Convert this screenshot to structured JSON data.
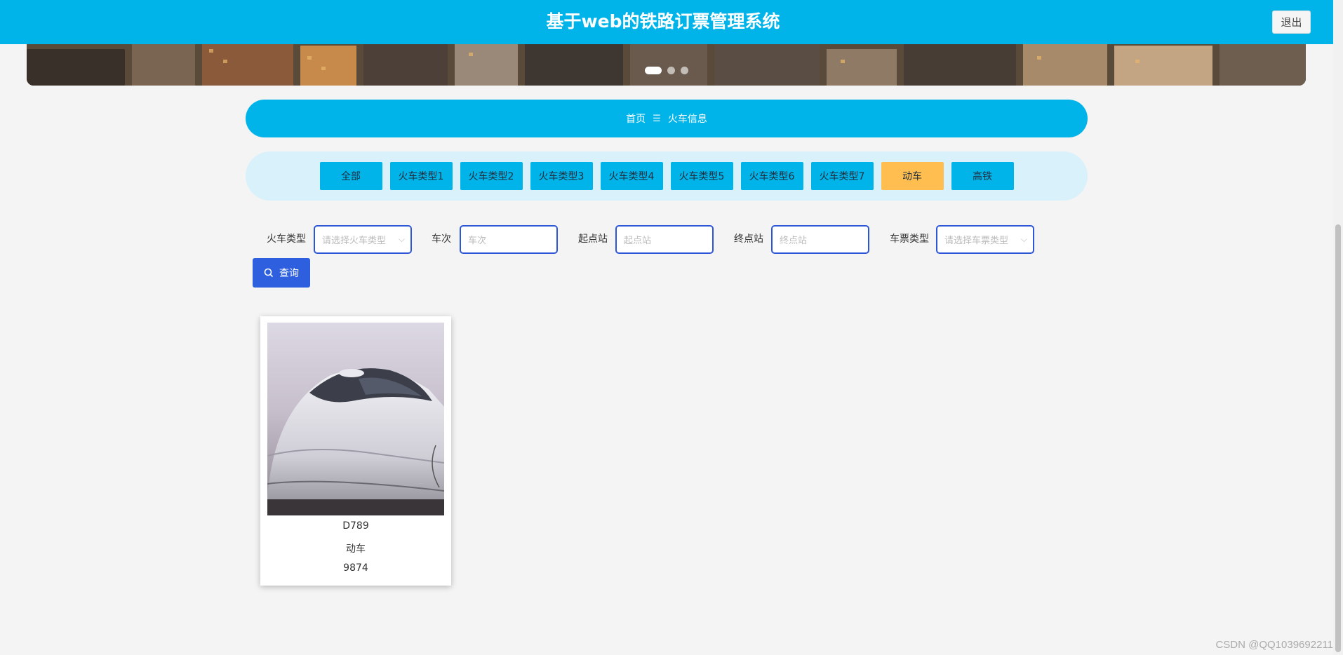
{
  "header": {
    "title": "基于web的铁路订票管理系统",
    "logout_label": "退出"
  },
  "breadcrumb": {
    "home": "首页",
    "separator": "☰",
    "current": "火车信息"
  },
  "tabs": [
    {
      "label": "全部",
      "active": false
    },
    {
      "label": "火车类型1",
      "active": false
    },
    {
      "label": "火车类型2",
      "active": false
    },
    {
      "label": "火车类型3",
      "active": false
    },
    {
      "label": "火车类型4",
      "active": false
    },
    {
      "label": "火车类型5",
      "active": false
    },
    {
      "label": "火车类型6",
      "active": false
    },
    {
      "label": "火车类型7",
      "active": false
    },
    {
      "label": "动车",
      "active": true
    },
    {
      "label": "高铁",
      "active": false
    }
  ],
  "search": {
    "train_type_label": "火车类型",
    "train_type_placeholder": "请选择火车类型",
    "train_no_label": "车次",
    "train_no_placeholder": "车次",
    "start_label": "起点站",
    "start_placeholder": "起点站",
    "end_label": "终点站",
    "end_placeholder": "终点站",
    "ticket_type_label": "车票类型",
    "ticket_type_placeholder": "请选择车票类型",
    "button_label": "查询"
  },
  "cards": [
    {
      "train_no": "D789",
      "type": "动车",
      "value": "9874"
    }
  ],
  "watermark": "CSDN @QQ1039692211",
  "colors": {
    "primary": "#00b4ea",
    "active_tab": "#ffbe4f",
    "search_button": "#2e5fde",
    "input_border": "#2d56d6"
  }
}
